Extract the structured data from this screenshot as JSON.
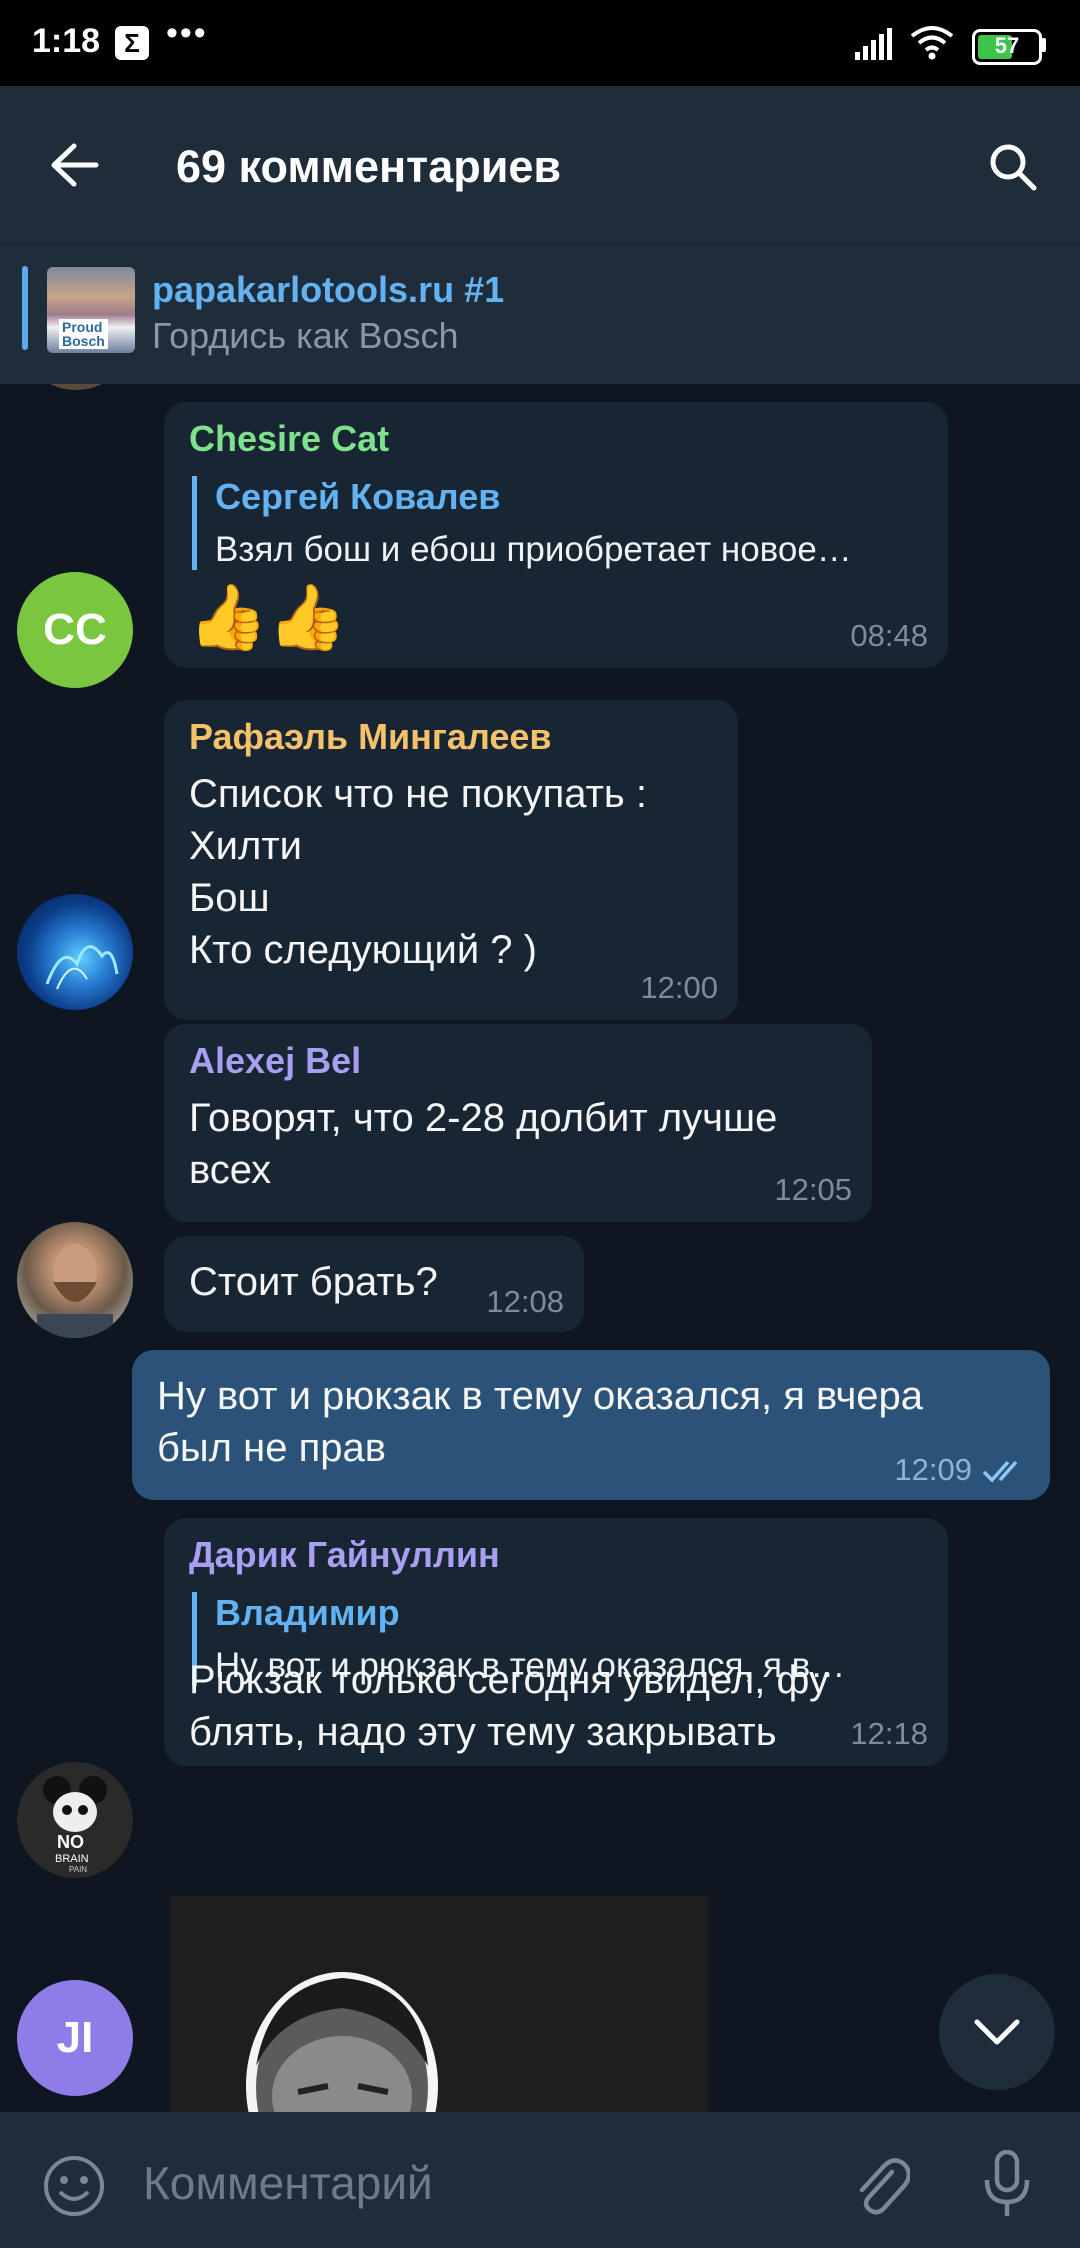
{
  "status_bar": {
    "time": "1:18",
    "notification_icon": "sigma-icon",
    "battery": "57"
  },
  "header": {
    "title": "69 комментариев",
    "back_icon": "arrow-left-icon",
    "search_icon": "search-icon"
  },
  "pinned": {
    "title": "papakarlotools.ru #1",
    "subtitle": "Гордись как Bosch",
    "thumb_text": "Proud\nBosch"
  },
  "messages": [
    {
      "author": "Chesire Cat",
      "author_color": "#7ee28c",
      "avatar": "CC",
      "avatar_color": "#7ac63f",
      "reply": {
        "author": "Сергей Ковалев",
        "text": "Взял бош и ебош приобретает новое…"
      },
      "text": "👍👍",
      "time": "08:48"
    },
    {
      "author": "Рафаэль Мингалеев",
      "author_color": "#f5c26b",
      "text": "Список что не покупать :\nХилти\nБош\nКто следующий ? )",
      "time": "12:00"
    },
    {
      "author": "Alexej Bel",
      "author_color": "#a99ef1",
      "text": "Говорят, что 2-28 долбит лучше\nвсех",
      "time": "12:05"
    },
    {
      "text": "Стоит брать?",
      "time": "12:08"
    },
    {
      "text": "Ну вот и рюкзак в тему оказался, я вчера\nбыл не прав",
      "time": "12:09",
      "outgoing": true
    },
    {
      "author": "Дарик Гайнуллин",
      "author_color": "#a99ef1",
      "reply": {
        "author": "Владимир",
        "text": "Ну вот и рюкзак в тему оказался, я в…"
      },
      "text": "Рюкзак только сегодня увидел, фу\nблять, надо эту тему закрывать",
      "time": "12:18"
    },
    {
      "avatar": "JI",
      "avatar_color": "#8e7ce8"
    }
  ],
  "avatar_logo_text": {
    "line1": "NO",
    "line2": "BRAIN",
    "line3": "PAIN"
  },
  "input": {
    "placeholder": "Комментарий",
    "emoji_icon": "smile-icon",
    "attach_icon": "paperclip-icon",
    "mic_icon": "microphone-icon"
  },
  "colors": {
    "background": "#0e1621",
    "bar": "#1f2c3a",
    "bubble_in": "#182533",
    "bubble_out": "#2b5278",
    "accent": "#63b3f3"
  }
}
